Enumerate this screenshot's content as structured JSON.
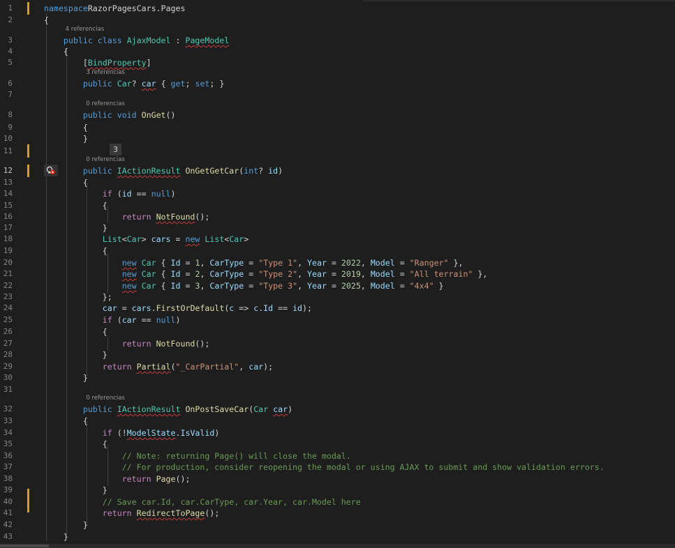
{
  "editor": {
    "badge": "3",
    "lines": [
      {
        "n": "1",
        "tokens": [
          [
            "k",
            "namespace"
          ],
          [
            "",
            "RazorPagesCars.Pages"
          ]
        ]
      },
      {
        "n": "2",
        "tokens": [
          [
            "",
            "{"
          ]
        ]
      },
      {
        "n": "3",
        "lens": "4 referencias",
        "tokens": [
          [
            "",
            "    "
          ],
          [
            "k",
            "public"
          ],
          [
            "",
            " "
          ],
          [
            "k",
            "class"
          ],
          [
            "",
            " "
          ],
          [
            "t",
            "AjaxModel"
          ],
          [
            "",
            " : "
          ],
          [
            "t sq",
            "PageModel"
          ]
        ]
      },
      {
        "n": "4",
        "tokens": [
          [
            "",
            "    {"
          ]
        ]
      },
      {
        "n": "5",
        "tokens": [
          [
            "",
            "        ["
          ],
          [
            "t sq",
            "BindProperty"
          ],
          [
            "",
            "]"
          ]
        ]
      },
      {
        "n": "6",
        "lens": "3 referencias",
        "tokens": [
          [
            "",
            "        "
          ],
          [
            "k",
            "public"
          ],
          [
            "",
            " "
          ],
          [
            "t",
            "Car"
          ],
          [
            "",
            "? "
          ],
          [
            "p sq",
            "car"
          ],
          [
            "",
            " { "
          ],
          [
            "k",
            "get"
          ],
          [
            "",
            "; "
          ],
          [
            "k",
            "set"
          ],
          [
            "",
            "; }"
          ]
        ]
      },
      {
        "n": "7",
        "tokens": []
      },
      {
        "n": "8",
        "lens": "0 referencias",
        "tokens": [
          [
            "",
            "        "
          ],
          [
            "k",
            "public"
          ],
          [
            "",
            " "
          ],
          [
            "k",
            "void"
          ],
          [
            "",
            " "
          ],
          [
            "m",
            "OnGet"
          ],
          [
            "",
            "()"
          ]
        ]
      },
      {
        "n": "9",
        "tokens": [
          [
            "",
            "        {"
          ]
        ]
      },
      {
        "n": "10",
        "tokens": [
          [
            "",
            "        }"
          ]
        ]
      },
      {
        "n": "11",
        "tokens": []
      },
      {
        "n": "12",
        "active": true,
        "lens": "0 referencias",
        "tokens": [
          [
            "",
            "        "
          ],
          [
            "k",
            "public"
          ],
          [
            "",
            " "
          ],
          [
            "t sq",
            "IActionResult"
          ],
          [
            "",
            " "
          ],
          [
            "m",
            "OnGetGetCar"
          ],
          [
            "",
            "("
          ],
          [
            "k",
            "int"
          ],
          [
            "",
            "? "
          ],
          [
            "p",
            "id"
          ],
          [
            "",
            ")"
          ]
        ]
      },
      {
        "n": "13",
        "tokens": [
          [
            "",
            "        {"
          ]
        ]
      },
      {
        "n": "14",
        "tokens": [
          [
            "",
            "            "
          ],
          [
            "c",
            "if"
          ],
          [
            "",
            " ("
          ],
          [
            "p",
            "id"
          ],
          [
            "",
            " == "
          ],
          [
            "k",
            "null"
          ],
          [
            "",
            ")"
          ]
        ]
      },
      {
        "n": "15",
        "tokens": [
          [
            "",
            "            {"
          ]
        ]
      },
      {
        "n": "16",
        "tokens": [
          [
            "",
            "                "
          ],
          [
            "c",
            "return"
          ],
          [
            "",
            " "
          ],
          [
            "m sq",
            "NotFound"
          ],
          [
            "",
            "();"
          ]
        ]
      },
      {
        "n": "17",
        "tokens": [
          [
            "",
            "            }"
          ]
        ]
      },
      {
        "n": "18",
        "tokens": [
          [
            "",
            "            "
          ],
          [
            "t",
            "List"
          ],
          [
            "",
            "<"
          ],
          [
            "t",
            "Car"
          ],
          [
            "",
            "> "
          ],
          [
            "p",
            "cars"
          ],
          [
            "",
            " = "
          ],
          [
            "k sq",
            "new"
          ],
          [
            "",
            " "
          ],
          [
            "t",
            "List"
          ],
          [
            "",
            "<"
          ],
          [
            "t",
            "Car"
          ],
          [
            "",
            ">"
          ]
        ]
      },
      {
        "n": "19",
        "tokens": [
          [
            "",
            "            {"
          ]
        ]
      },
      {
        "n": "20",
        "tokens": [
          [
            "",
            "                "
          ],
          [
            "k sq",
            "new"
          ],
          [
            "",
            " "
          ],
          [
            "t",
            "Car"
          ],
          [
            "",
            " { "
          ],
          [
            "p",
            "Id"
          ],
          [
            "",
            " = "
          ],
          [
            "n",
            "1"
          ],
          [
            "",
            ", "
          ],
          [
            "p",
            "CarType"
          ],
          [
            "",
            " = "
          ],
          [
            "s",
            "\"Type 1\""
          ],
          [
            "",
            ", "
          ],
          [
            "p",
            "Year"
          ],
          [
            "",
            " = "
          ],
          [
            "n",
            "2022"
          ],
          [
            "",
            ", "
          ],
          [
            "p",
            "Model"
          ],
          [
            "",
            " = "
          ],
          [
            "s",
            "\"Ranger\""
          ],
          [
            "",
            " },"
          ]
        ]
      },
      {
        "n": "21",
        "tokens": [
          [
            "",
            "                "
          ],
          [
            "k sq",
            "new"
          ],
          [
            "",
            " "
          ],
          [
            "t",
            "Car"
          ],
          [
            "",
            " { "
          ],
          [
            "p",
            "Id"
          ],
          [
            "",
            " = "
          ],
          [
            "n",
            "2"
          ],
          [
            "",
            ", "
          ],
          [
            "p",
            "CarType"
          ],
          [
            "",
            " = "
          ],
          [
            "s",
            "\"Type 2\""
          ],
          [
            "",
            ", "
          ],
          [
            "p",
            "Year"
          ],
          [
            "",
            " = "
          ],
          [
            "n",
            "2019"
          ],
          [
            "",
            ", "
          ],
          [
            "p",
            "Model"
          ],
          [
            "",
            " = "
          ],
          [
            "s",
            "\"All terrain\""
          ],
          [
            "",
            " },"
          ]
        ]
      },
      {
        "n": "22",
        "tokens": [
          [
            "",
            "                "
          ],
          [
            "k sq",
            "new"
          ],
          [
            "",
            " "
          ],
          [
            "t",
            "Car"
          ],
          [
            "",
            " { "
          ],
          [
            "p",
            "Id"
          ],
          [
            "",
            " = "
          ],
          [
            "n",
            "3"
          ],
          [
            "",
            ", "
          ],
          [
            "p",
            "CarType"
          ],
          [
            "",
            " = "
          ],
          [
            "s",
            "\"Type 3\""
          ],
          [
            "",
            ", "
          ],
          [
            "p",
            "Year"
          ],
          [
            "",
            " = "
          ],
          [
            "n",
            "2025"
          ],
          [
            "",
            ", "
          ],
          [
            "p",
            "Model"
          ],
          [
            "",
            " = "
          ],
          [
            "s",
            "\"4x4\""
          ],
          [
            "",
            " }"
          ]
        ]
      },
      {
        "n": "23",
        "tokens": [
          [
            "",
            "            };"
          ]
        ]
      },
      {
        "n": "24",
        "tokens": [
          [
            "",
            "            "
          ],
          [
            "p",
            "car"
          ],
          [
            "",
            " = "
          ],
          [
            "p",
            "cars"
          ],
          [
            "",
            "."
          ],
          [
            "m",
            "FirstOrDefault"
          ],
          [
            "",
            "("
          ],
          [
            "p",
            "c"
          ],
          [
            "",
            " => "
          ],
          [
            "p",
            "c"
          ],
          [
            "",
            "."
          ],
          [
            "p",
            "Id"
          ],
          [
            "",
            " == "
          ],
          [
            "p",
            "id"
          ],
          [
            "",
            ");"
          ]
        ]
      },
      {
        "n": "25",
        "tokens": [
          [
            "",
            "            "
          ],
          [
            "c",
            "if"
          ],
          [
            "",
            " ("
          ],
          [
            "p",
            "car"
          ],
          [
            "",
            " == "
          ],
          [
            "k",
            "null"
          ],
          [
            "",
            ")"
          ]
        ]
      },
      {
        "n": "26",
        "tokens": [
          [
            "",
            "            {"
          ]
        ]
      },
      {
        "n": "27",
        "tokens": [
          [
            "",
            "                "
          ],
          [
            "c",
            "return"
          ],
          [
            "",
            " "
          ],
          [
            "m",
            "NotFound"
          ],
          [
            "",
            "();"
          ]
        ]
      },
      {
        "n": "28",
        "tokens": [
          [
            "",
            "            }"
          ]
        ]
      },
      {
        "n": "29",
        "tokens": [
          [
            "",
            "            "
          ],
          [
            "c",
            "return"
          ],
          [
            "",
            " "
          ],
          [
            "m sq",
            "Partial"
          ],
          [
            "",
            "("
          ],
          [
            "s",
            "\"_CarPartial\""
          ],
          [
            "",
            ", "
          ],
          [
            "p",
            "car"
          ],
          [
            "",
            ");"
          ]
        ]
      },
      {
        "n": "30",
        "tokens": [
          [
            "",
            "        }"
          ]
        ]
      },
      {
        "n": "31",
        "tokens": []
      },
      {
        "n": "32",
        "lens": "0 referencias",
        "tokens": [
          [
            "",
            "        "
          ],
          [
            "k",
            "public"
          ],
          [
            "",
            " "
          ],
          [
            "t sq",
            "IActionResult"
          ],
          [
            "",
            " "
          ],
          [
            "m",
            "OnPostSaveCar"
          ],
          [
            "",
            "("
          ],
          [
            "t",
            "Car"
          ],
          [
            "",
            " "
          ],
          [
            "p sq",
            "car"
          ],
          [
            "",
            ")"
          ]
        ]
      },
      {
        "n": "33",
        "tokens": [
          [
            "",
            "        {"
          ]
        ]
      },
      {
        "n": "34",
        "tokens": [
          [
            "",
            "            "
          ],
          [
            "c",
            "if"
          ],
          [
            "",
            " (!"
          ],
          [
            "p sq",
            "ModelState"
          ],
          [
            "",
            "."
          ],
          [
            "p",
            "IsValid"
          ],
          [
            "",
            ")"
          ]
        ]
      },
      {
        "n": "35",
        "tokens": [
          [
            "",
            "            {"
          ]
        ]
      },
      {
        "n": "36",
        "tokens": [
          [
            "",
            "                "
          ],
          [
            "cm",
            "// Note: returning Page() will close the modal."
          ]
        ]
      },
      {
        "n": "37",
        "tokens": [
          [
            "",
            "                "
          ],
          [
            "cm",
            "// For production, consider reopening the modal or using AJAX to submit and show validation errors."
          ]
        ]
      },
      {
        "n": "38",
        "tokens": [
          [
            "",
            "                "
          ],
          [
            "c",
            "return"
          ],
          [
            "",
            " "
          ],
          [
            "m",
            "Page"
          ],
          [
            "",
            "();"
          ]
        ]
      },
      {
        "n": "39",
        "tokens": [
          [
            "",
            "            }"
          ]
        ]
      },
      {
        "n": "40",
        "tokens": [
          [
            "",
            "            "
          ],
          [
            "cm",
            "// Save car.Id, car.CarType, car.Year, car.Model here"
          ]
        ]
      },
      {
        "n": "41",
        "tokens": [
          [
            "",
            "            "
          ],
          [
            "c",
            "return"
          ],
          [
            "",
            " "
          ],
          [
            "m sq",
            "RedirectToPage"
          ],
          [
            "",
            "();"
          ]
        ]
      },
      {
        "n": "42",
        "tokens": [
          [
            "",
            "        }"
          ]
        ]
      },
      {
        "n": "43",
        "tokens": [
          [
            "",
            "    }"
          ]
        ]
      }
    ]
  }
}
